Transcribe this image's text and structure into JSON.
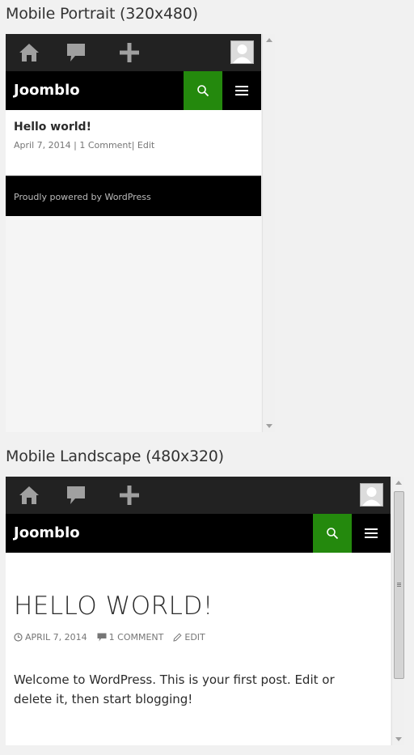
{
  "sections": {
    "portrait": {
      "heading": "Mobile Portrait (320x480)"
    },
    "landscape": {
      "heading": "Mobile Landscape (480x320)"
    }
  },
  "adminbar": {
    "icons": [
      "home-icon",
      "comments-icon",
      "new-content-icon",
      "avatar"
    ]
  },
  "site": {
    "title": "Joomblo"
  },
  "post": {
    "title_portrait": "Hello world!",
    "title_landscape": "HELLO WORLD!",
    "meta_portrait": {
      "date": "April 7, 2014",
      "sep1": " | ",
      "comments": "1 Comment",
      "sep2": "| ",
      "edit": "Edit"
    },
    "meta_landscape": {
      "date": "APRIL 7, 2014",
      "comments": "1 COMMENT",
      "edit": "EDIT"
    },
    "body": "Welcome to WordPress. This is your first post. Edit or delete it, then start blogging!"
  },
  "footer": {
    "text": "Proudly powered by WordPress"
  },
  "colors": {
    "accent": "#24890d",
    "adminbar": "#222222",
    "header": "#000000"
  }
}
